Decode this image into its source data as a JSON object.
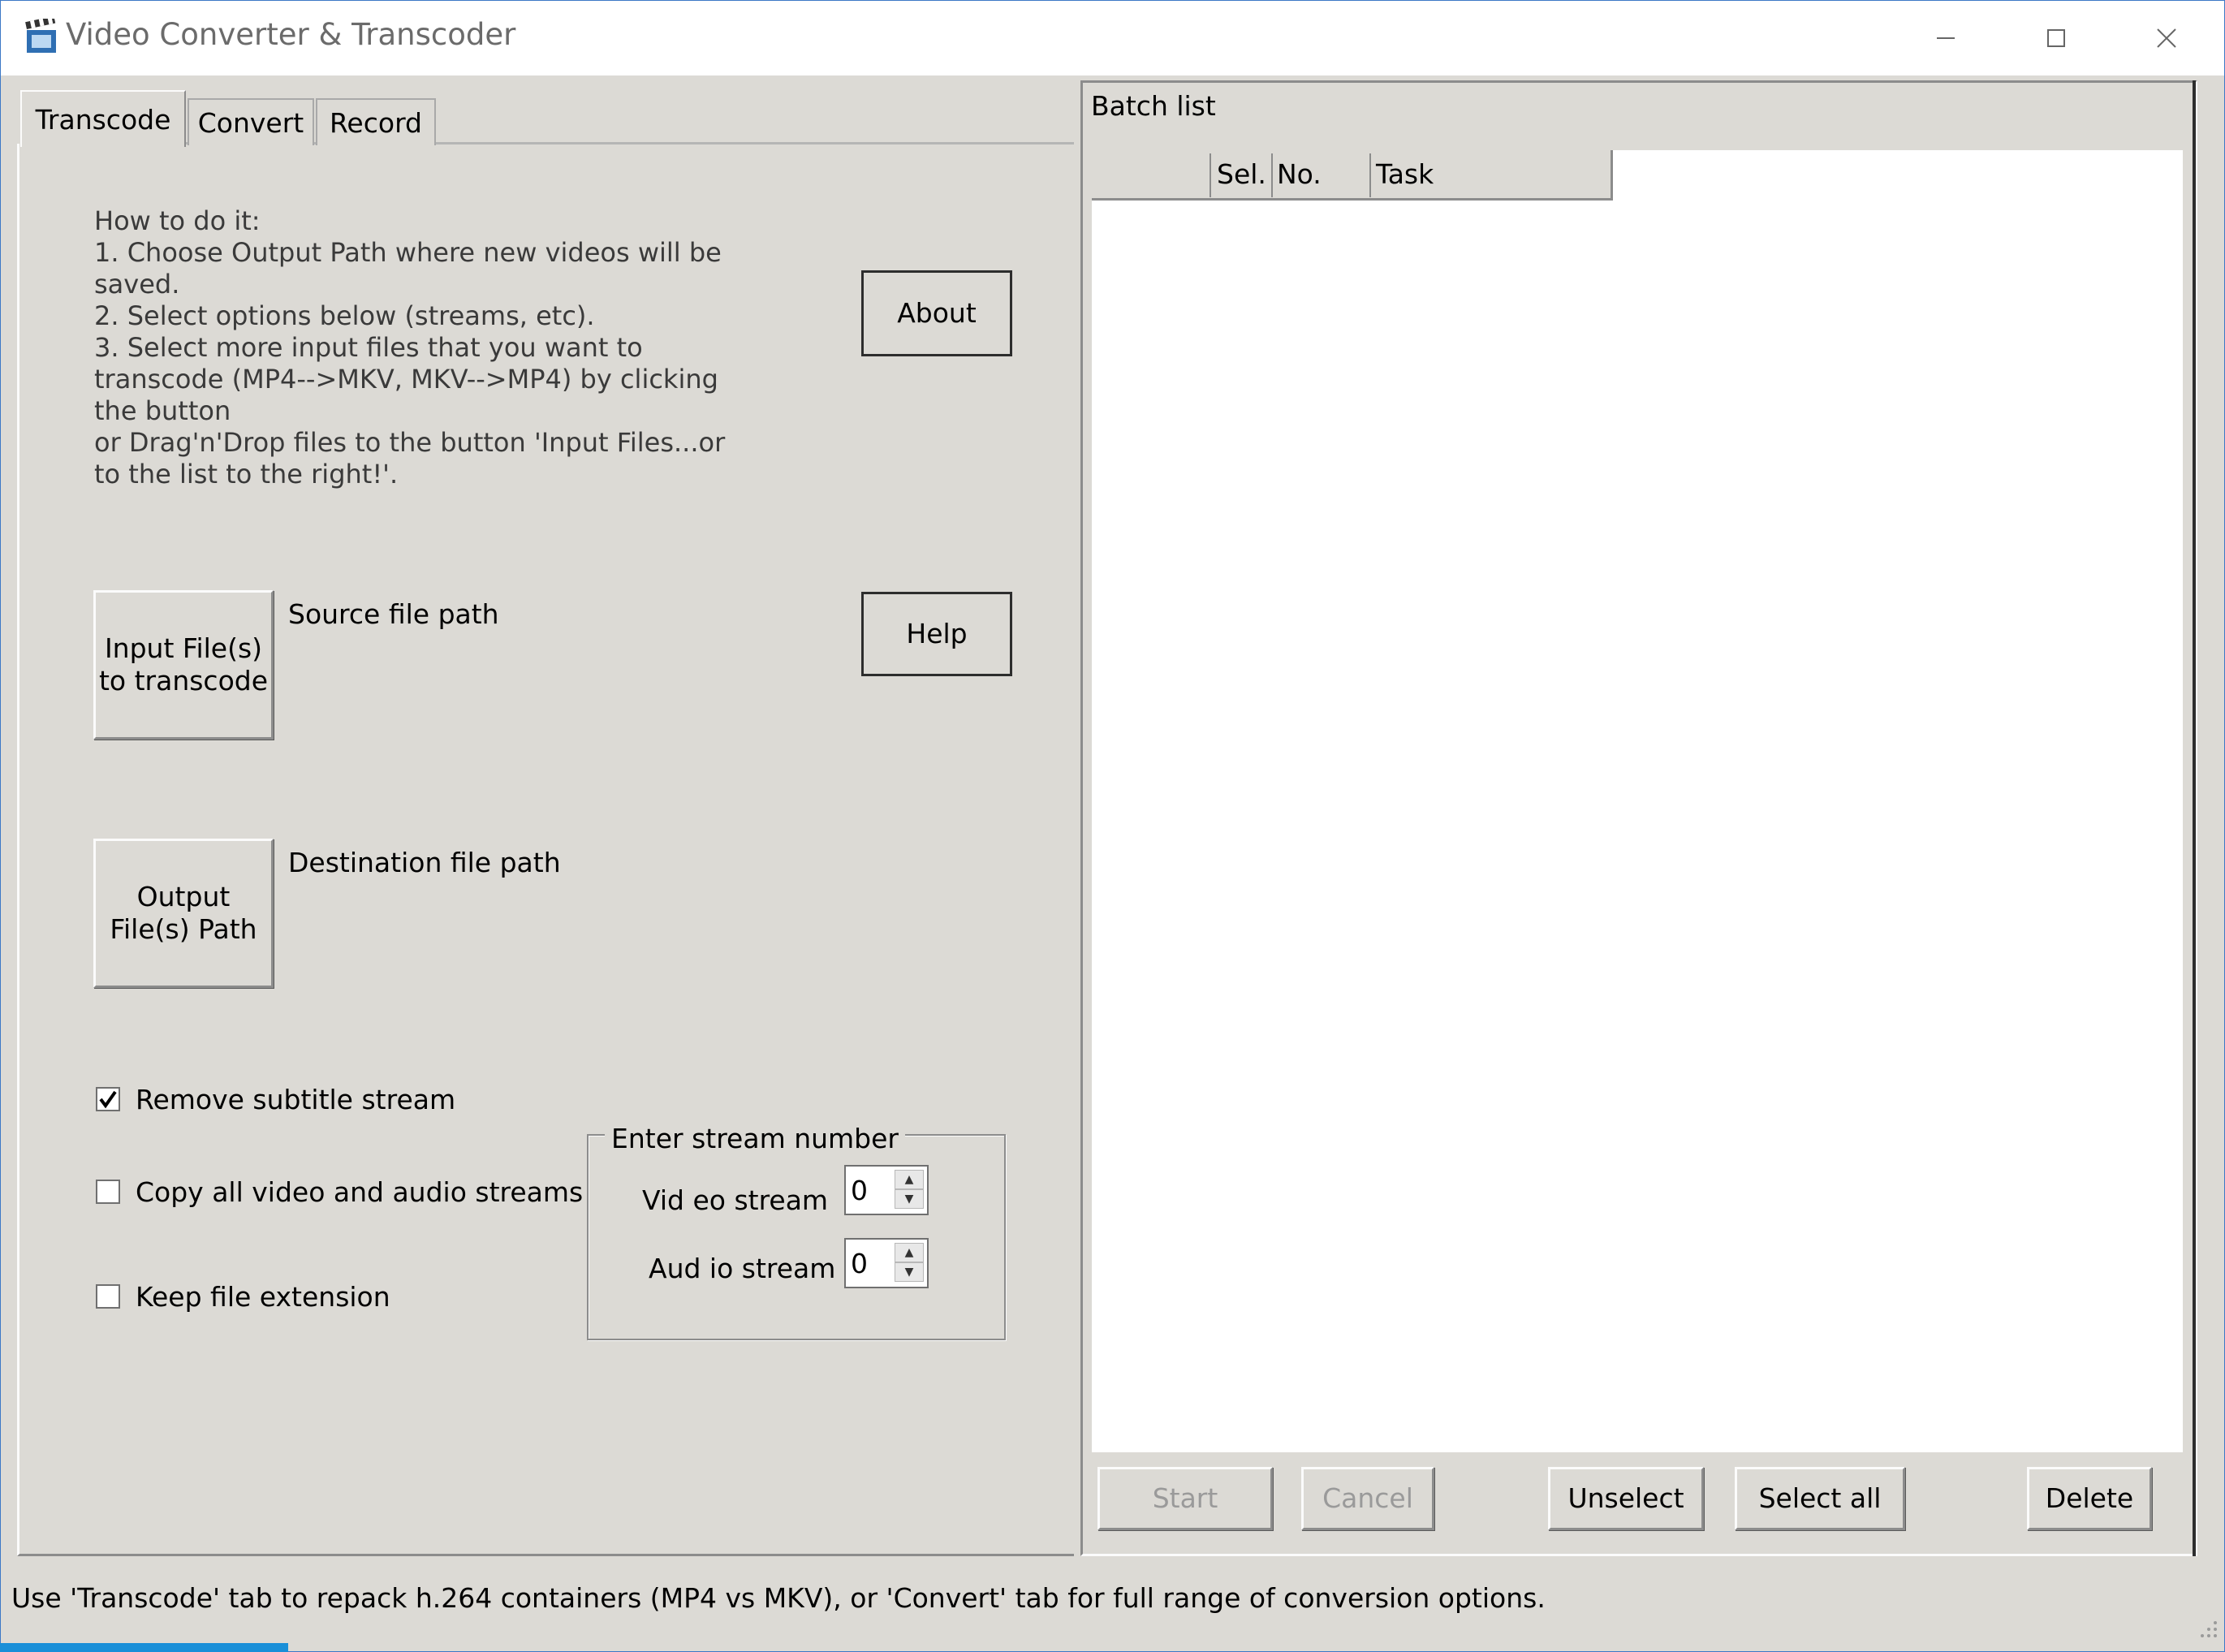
{
  "window": {
    "title": "Video Converter & Transcoder"
  },
  "tabs": [
    {
      "label": "Transcode",
      "active": true
    },
    {
      "label": "Convert",
      "active": false
    },
    {
      "label": "Record",
      "active": false
    }
  ],
  "instructions": [
    "How to do it:",
    "1. Choose Output Path where new videos will be",
    "saved.",
    "2. Select options below (streams, etc).",
    "3. Select more input files that you want to",
    "transcode (MP4-->MKV, MKV-->MP4) by clicking",
    "the button",
    "or Drag'n'Drop files to the button 'Input Files...or",
    "to the list to the right!'."
  ],
  "buttons": {
    "about": "About",
    "help": "Help",
    "input_line1": "Input File(s)",
    "input_line2": "to transcode",
    "output_line1": "Output",
    "output_line2": "File(s) Path"
  },
  "labels": {
    "source_path": "Source file path",
    "destination_path": "Destination file path"
  },
  "options": {
    "remove_subtitle": {
      "label": "Remove subtitle stream",
      "checked": true
    },
    "copy_all": {
      "label": "Copy all video and audio streams",
      "checked": false
    },
    "keep_extension": {
      "label": "Keep file extension",
      "checked": false
    }
  },
  "stream_group": {
    "title": "Enter stream number",
    "video_label": "Vid eo stream",
    "video_value": "0",
    "audio_label": "Aud io stream",
    "audio_value": "0"
  },
  "batch": {
    "title": "Batch list",
    "columns": [
      "Sel.",
      "No.",
      "Task"
    ],
    "rows": []
  },
  "actions": {
    "start": "Start",
    "cancel": "Cancel",
    "unselect": "Unselect",
    "select_all": "Select all",
    "delete": "Delete"
  },
  "status_text": "Use 'Transcode' tab to repack h.264 containers (MP4 vs MKV), or 'Convert' tab for full range of conversion options.",
  "icons": {
    "app": "clapperboard-icon",
    "minimize": "minimize-icon",
    "maximize": "maximize-icon",
    "close": "close-icon",
    "check": "checkmark-icon",
    "spin_up": "spin-up-icon",
    "spin_down": "spin-down-icon",
    "grip": "resize-grip-icon"
  },
  "colors": {
    "accent": "#3c78c6",
    "window_bg": "#dcdad5",
    "list_bg": "#ffffff",
    "taskbar_blue": "#1a8fd8"
  }
}
